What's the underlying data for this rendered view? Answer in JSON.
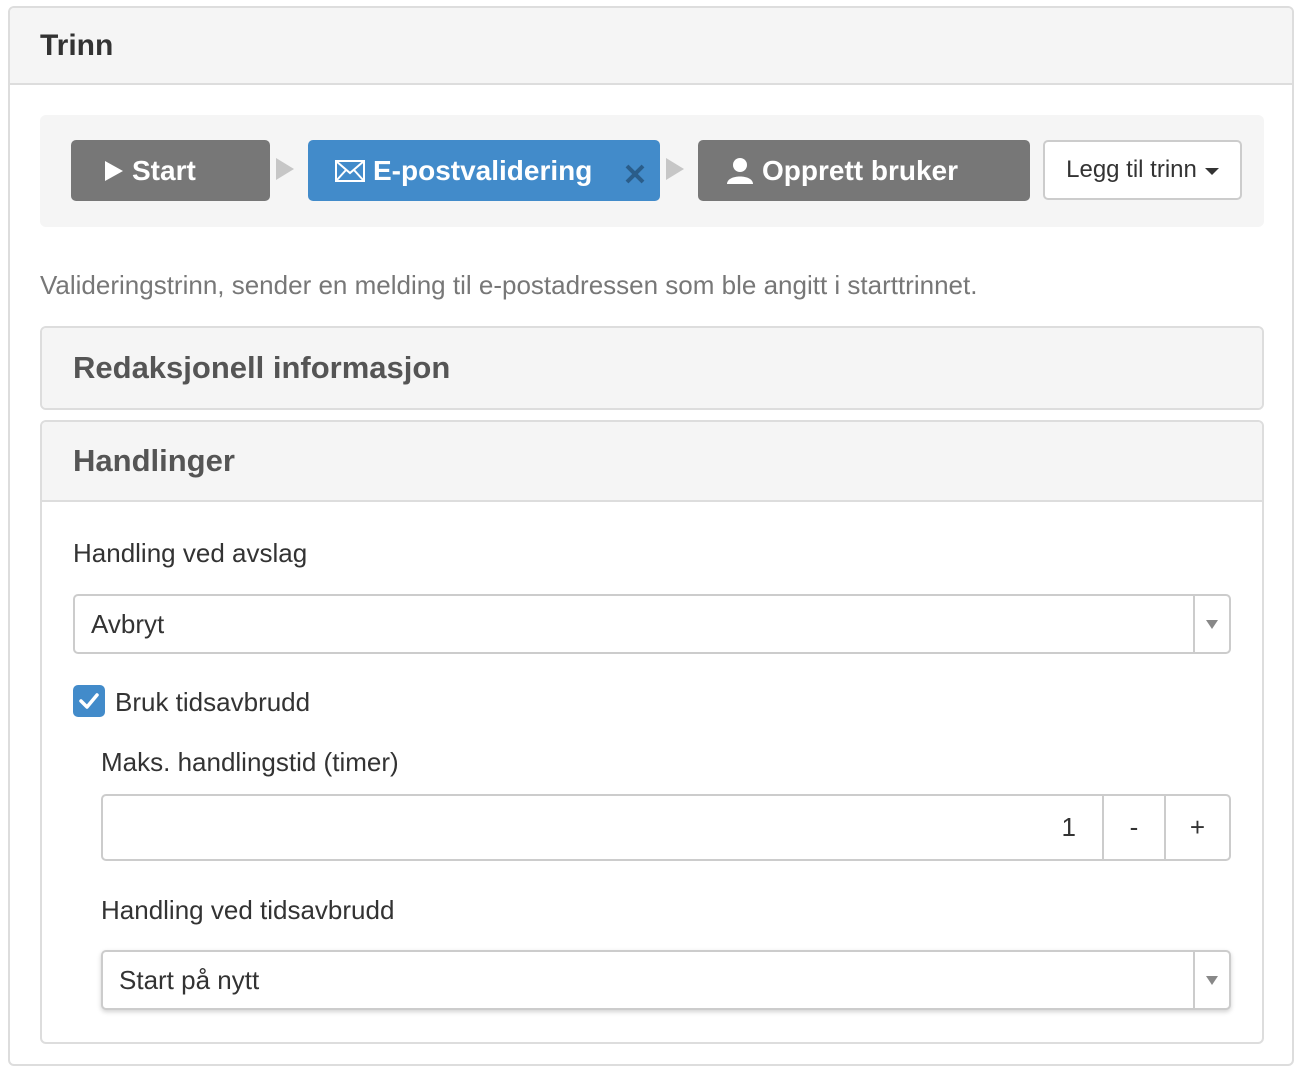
{
  "panel": {
    "title": "Trinn"
  },
  "steps": [
    {
      "label": "Start",
      "icon": "play-icon",
      "state": "inactive"
    },
    {
      "label": "E-postvalidering",
      "icon": "envelope-icon",
      "state": "active",
      "removable": true
    },
    {
      "label": "Opprett bruker",
      "icon": "user-icon",
      "state": "inactive"
    }
  ],
  "add_step": {
    "label": "Legg til trinn"
  },
  "description": "Valideringstrinn, sender en melding til e-postadressen som ble angitt i starttrinnet.",
  "sections": {
    "editorial": {
      "title": "Redaksjonell informasjon"
    },
    "actions": {
      "title": "Handlinger",
      "reject_action": {
        "label": "Handling ved avslag",
        "value": "Avbryt"
      },
      "use_timeout": {
        "label": "Bruk tidsavbrudd",
        "checked": true
      },
      "max_time": {
        "label": "Maks. handlingstid (timer)",
        "value": "1",
        "decrement": "-",
        "increment": "+"
      },
      "timeout_action": {
        "label": "Handling ved tidsavbrudd",
        "value": "Start på nytt"
      }
    }
  },
  "colors": {
    "active_step": "#428bca",
    "inactive_step": "#777777",
    "checkbox": "#428bca"
  }
}
